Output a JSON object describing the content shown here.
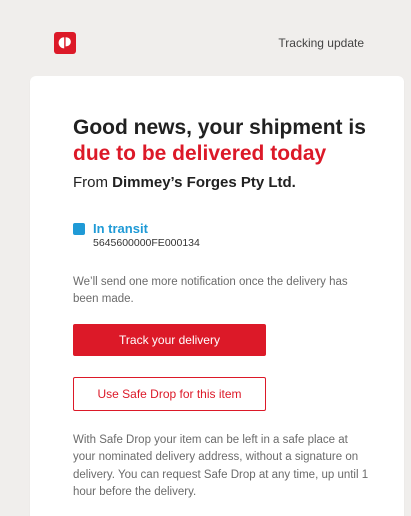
{
  "header": {
    "logo_icon": "australia-post-logo-icon",
    "title": "Tracking update"
  },
  "headline": {
    "line1": "Good news, your shipment is",
    "accent": "due to be delivered today"
  },
  "from": {
    "prefix": "From ",
    "sender": "Dimmey’s Forges Pty Ltd."
  },
  "status": {
    "label": "In transit",
    "tracking_number": "5645600000FE000134"
  },
  "notice": "We’ll send one more notification once the delivery has been made.",
  "buttons": {
    "track_label": "Track your delivery",
    "safedrop_label": "Use Safe Drop for this item"
  },
  "safedrop_info": "With Safe Drop your item can be left in a safe place at your nominated delivery address, without a signature on delivery. You can request Safe Drop at any time, up until 1 hour before the delivery.",
  "colors": {
    "brand_red": "#dc1928",
    "status_blue": "#1f9ad6",
    "background": "#f0eeec"
  }
}
